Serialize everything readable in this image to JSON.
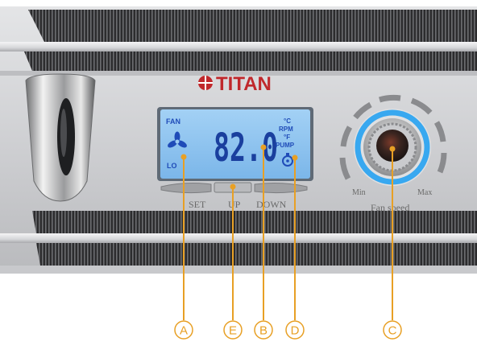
{
  "brand": {
    "name": "TITAN"
  },
  "lcd": {
    "temperature_reading": "82.0",
    "fan_label": "FAN",
    "level_label": "LO",
    "unit_celsius": "°C",
    "unit_rpm": "RPM",
    "unit_fahrenheit": "°F",
    "pump_label": "PUMP"
  },
  "buttons": {
    "set_label": "SET",
    "up_label": "UP",
    "down_label": "DOWN"
  },
  "knob": {
    "min_label": "Min",
    "max_label": "Max",
    "caption": "Fan speed"
  },
  "callouts": [
    {
      "letter": "A"
    },
    {
      "letter": "E"
    },
    {
      "letter": "B"
    },
    {
      "letter": "D"
    },
    {
      "letter": "C"
    }
  ],
  "colors": {
    "lcd_backlight": "#8fc3ee",
    "callout_orange": "#e8a025",
    "brand_red": "#c0282c",
    "knob_glow": "#38a8f0"
  },
  "icons": {
    "fan": "fan-icon",
    "pump": "pump-icon",
    "logo": "titan-logo-icon"
  }
}
